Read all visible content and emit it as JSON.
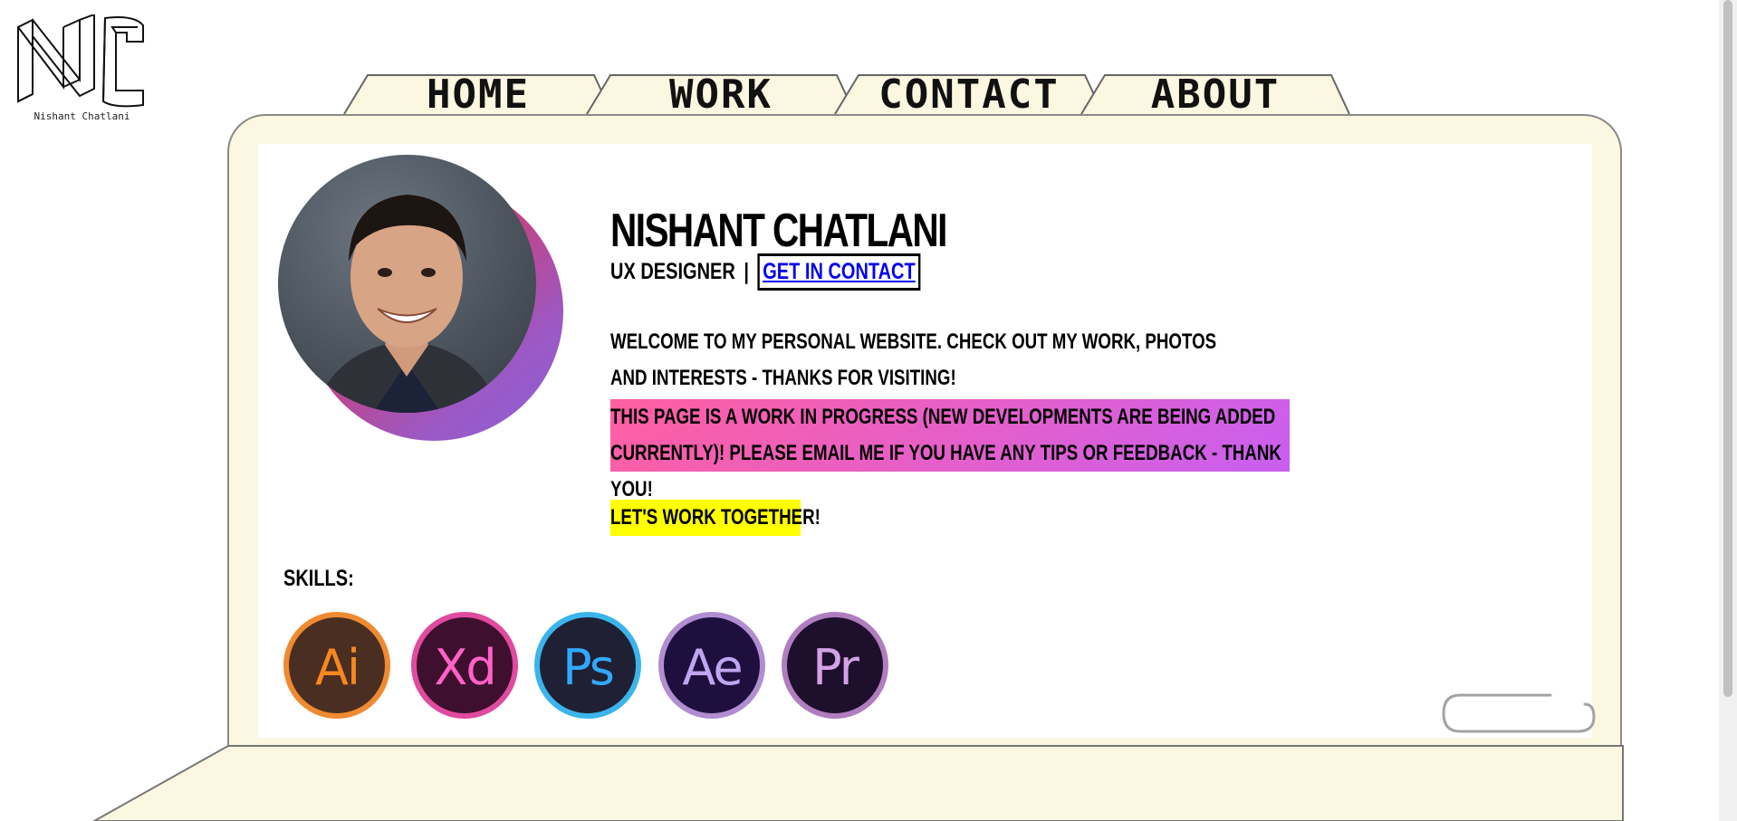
{
  "logo": {
    "mark_text": "NC",
    "caption": "Nishant Chatlani"
  },
  "nav": {
    "tabs": [
      {
        "label": "HOME"
      },
      {
        "label": "WORK"
      },
      {
        "label": "CONTACT"
      },
      {
        "label": "ABOUT"
      }
    ]
  },
  "hero": {
    "name": "NISHANT CHATLANI",
    "role": "UX DESIGNER",
    "separator": "|",
    "contact_link": "GET IN CONTACT",
    "welcome": "WELCOME TO MY PERSONAL WEBSITE. CHECK OUT MY WORK, PHOTOS AND INTERESTS - THANKS FOR VISITING!",
    "notice": "THIS PAGE IS A WORK IN PROGRESS (NEW DEVELOPMENTS ARE BEING ADDED CURRENTLY)! PLEASE EMAIL ME IF YOU HAVE ANY TIPS OR FEEDBACK - THANK YOU!",
    "cta": "LET'S WORK TOGETHER!"
  },
  "skills": {
    "label": "SKILLS:",
    "items": [
      {
        "abbr": "Ai",
        "text_color": "#f7881e",
        "bg_color": "#4a2e22",
        "ring_color": "#f08a30",
        "icon": "adobe-illustrator-icon"
      },
      {
        "abbr": "Xd",
        "text_color": "#ff61c8",
        "bg_color": "#3e0f2e",
        "ring_color": "#e04a9f",
        "icon": "adobe-xd-icon"
      },
      {
        "abbr": "Ps",
        "text_color": "#31a8ff",
        "bg_color": "#1f2033",
        "ring_color": "#3bb4eb",
        "icon": "adobe-photoshop-icon"
      },
      {
        "abbr": "Ae",
        "text_color": "#c0a6f0",
        "bg_color": "#1e0f3e",
        "ring_color": "#b08ed0",
        "icon": "adobe-after-effects-icon"
      },
      {
        "abbr": "Pr",
        "text_color": "#d4a2e6",
        "bg_color": "#1e0f2d",
        "ring_color": "#b07dbe",
        "icon": "adobe-premiere-icon"
      }
    ]
  },
  "colors": {
    "folder_bg": "#fbf7e1",
    "link": "#0000ee",
    "highlight_yellow": "#ffff00",
    "notice_gradient_start": "#ff5fa0",
    "notice_gradient_end": "#c85ff0"
  }
}
